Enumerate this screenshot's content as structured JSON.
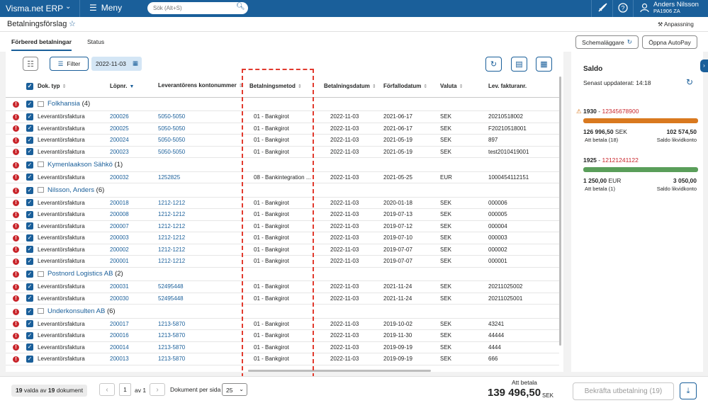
{
  "topbar": {
    "brand": "Visma.net ERP",
    "menu_label": "Meny",
    "search_placeholder": "Sök (Alt+S)",
    "user_name": "Anders Nilsson",
    "user_company": "PA1906 ZA"
  },
  "header": {
    "title": "Betalningsförslag",
    "customize_label": "Anpassning"
  },
  "tabs": [
    {
      "label": "Förbered betalningar",
      "active": true
    },
    {
      "label": "Status",
      "active": false
    }
  ],
  "actions": {
    "scheduler_label": "Schemaläggare",
    "autopay_label": "Öppna AutoPay"
  },
  "toolbar": {
    "filter_label": "Filter",
    "date_value": "2022-11-03"
  },
  "table": {
    "columns": [
      "Dok. typ",
      "Löpnr.",
      "Leverantörens kontonummer",
      "Betalningsmetod",
      "Betalningsdatum",
      "Förfallodatum",
      "Valuta",
      "Lev. fakturanr."
    ],
    "groups": [
      {
        "name": "Folkhansia",
        "count": "(4)",
        "rows": [
          [
            "Leverantörsfaktura",
            "200026",
            "5050-5050",
            "01 - Bankgirot",
            "2022-11-03",
            "2021-06-17",
            "SEK",
            "20210518002"
          ],
          [
            "Leverantörsfaktura",
            "200025",
            "5050-5050",
            "01 - Bankgirot",
            "2022-11-03",
            "2021-06-17",
            "SEK",
            "F20210518001"
          ],
          [
            "Leverantörsfaktura",
            "200024",
            "5050-5050",
            "01 - Bankgirot",
            "2022-11-03",
            "2021-05-19",
            "SEK",
            "897"
          ],
          [
            "Leverantörsfaktura",
            "200023",
            "5050-5050",
            "01 - Bankgirot",
            "2022-11-03",
            "2021-05-19",
            "SEK",
            "test2010419001"
          ]
        ]
      },
      {
        "name": "Kymenlaakson Sähkö",
        "count": "(1)",
        "rows": [
          [
            "Leverantörsfaktura",
            "200032",
            "1252825",
            "08 - Bankintegration ...",
            "2022-11-03",
            "2021-05-25",
            "EUR",
            "1000454112151"
          ]
        ]
      },
      {
        "name": "Nilsson, Anders",
        "count": "(6)",
        "rows": [
          [
            "Leverantörsfaktura",
            "200018",
            "1212-1212",
            "01 - Bankgirot",
            "2022-11-03",
            "2020-01-18",
            "SEK",
            "000006"
          ],
          [
            "Leverantörsfaktura",
            "200008",
            "1212-1212",
            "01 - Bankgirot",
            "2022-11-03",
            "2019-07-13",
            "SEK",
            "000005"
          ],
          [
            "Leverantörsfaktura",
            "200007",
            "1212-1212",
            "01 - Bankgirot",
            "2022-11-03",
            "2019-07-12",
            "SEK",
            "000004"
          ],
          [
            "Leverantörsfaktura",
            "200003",
            "1212-1212",
            "01 - Bankgirot",
            "2022-11-03",
            "2019-07-10",
            "SEK",
            "000003"
          ],
          [
            "Leverantörsfaktura",
            "200002",
            "1212-1212",
            "01 - Bankgirot",
            "2022-11-03",
            "2019-07-07",
            "SEK",
            "000002"
          ],
          [
            "Leverantörsfaktura",
            "200001",
            "1212-1212",
            "01 - Bankgirot",
            "2022-11-03",
            "2019-07-07",
            "SEK",
            "000001"
          ]
        ]
      },
      {
        "name": "Postnord Logistics AB",
        "count": "(2)",
        "rows": [
          [
            "Leverantörsfaktura",
            "200031",
            "52495448",
            "01 - Bankgirot",
            "2022-11-03",
            "2021-11-24",
            "SEK",
            "20211025002"
          ],
          [
            "Leverantörsfaktura",
            "200030",
            "52495448",
            "01 - Bankgirot",
            "2022-11-03",
            "2021-11-24",
            "SEK",
            "20211025001"
          ]
        ]
      },
      {
        "name": "Underkonsulten AB",
        "count": "(6)",
        "rows": [
          [
            "Leverantörsfaktura",
            "200017",
            "1213-5870",
            "01 - Bankgirot",
            "2022-11-03",
            "2019-10-02",
            "SEK",
            "43241"
          ],
          [
            "Leverantörsfaktura",
            "200016",
            "1213-5870",
            "01 - Bankgirot",
            "2022-11-03",
            "2019-11-30",
            "SEK",
            "44444"
          ],
          [
            "Leverantörsfaktura",
            "200014",
            "1213-5870",
            "01 - Bankgirot",
            "2022-11-03",
            "2019-09-19",
            "SEK",
            "4444"
          ],
          [
            "Leverantörsfaktura",
            "200013",
            "1213-5870",
            "01 - Bankgirot",
            "2022-11-03",
            "2019-09-19",
            "SEK",
            "666"
          ]
        ]
      }
    ]
  },
  "saldo": {
    "title": "Saldo",
    "updated": "Senast uppdaterat: 14:18",
    "accounts": [
      {
        "code": "1930",
        "number": "12345678900",
        "warning": true,
        "color": "#d9791f",
        "amount": "126 996,50",
        "currency": "SEK",
        "to_pay_label": "Att betala (18)",
        "balance": "102 574,50",
        "balance_label": "Saldo likvidkonto"
      },
      {
        "code": "1925",
        "number": "12121241122",
        "warning": false,
        "color": "#5a9e5a",
        "amount": "1 250,00",
        "currency": "EUR",
        "to_pay_label": "Att betala (1)",
        "balance": "3 050,00",
        "balance_label": "Saldo likvidkonto"
      }
    ]
  },
  "footer": {
    "selected_count": "19",
    "selected_text": "valda av",
    "total_count": "19",
    "doc_text": "dokument",
    "page": "1",
    "page_of": "av 1",
    "per_page_label": "Dokument per sida",
    "per_page_value": "25",
    "to_pay_label": "Att betala",
    "to_pay_amount": "139 496,50",
    "to_pay_currency": "SEK",
    "confirm_label": "Bekräfta utbetalning (19)"
  }
}
